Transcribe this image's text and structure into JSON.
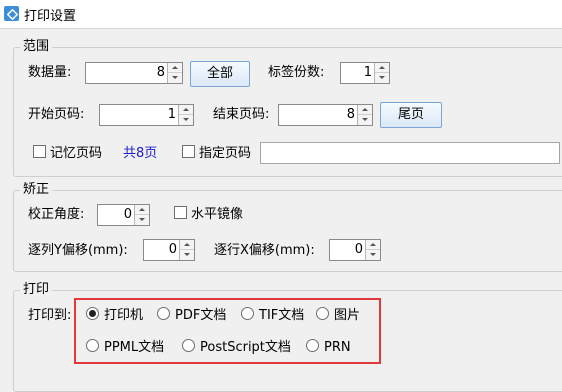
{
  "window": {
    "title": "打印设置",
    "app_icon": "app-settings-icon"
  },
  "range": {
    "group_label": "范围",
    "quantity_label": "数据量:",
    "quantity_value": "8",
    "all_button": "全部",
    "copies_label": "标签份数:",
    "copies_value": "1",
    "start_page_label": "开始页码:",
    "start_page_value": "1",
    "end_page_label": "结束页码:",
    "end_page_value": "8",
    "last_page_button": "尾页",
    "remember_page_label": "记忆页码",
    "remember_page_checked": false,
    "total_pages_text": "共8页",
    "specify_page_label": "指定页码",
    "specify_page_checked": false,
    "specify_page_value": ""
  },
  "correction": {
    "group_label": "矫正",
    "angle_label": "校正角度:",
    "angle_value": "0",
    "mirror_label": "水平镜像",
    "mirror_checked": false,
    "column_y_offset_label": "逐列Y偏移(mm):",
    "column_y_offset_value": "0",
    "row_x_offset_label": "逐行X偏移(mm):",
    "row_x_offset_value": "0"
  },
  "print": {
    "group_label": "打印",
    "print_to_label": "打印到:",
    "selected": "打印机",
    "options": [
      "打印机",
      "PDF文档",
      "TIF文档",
      "图片",
      "PPML文档",
      "PostScript文档",
      "PRN"
    ]
  },
  "colors": {
    "highlight_border": "#e23a3a",
    "link_text": "#1b1bd0",
    "button_border": "#7aa6d6"
  }
}
